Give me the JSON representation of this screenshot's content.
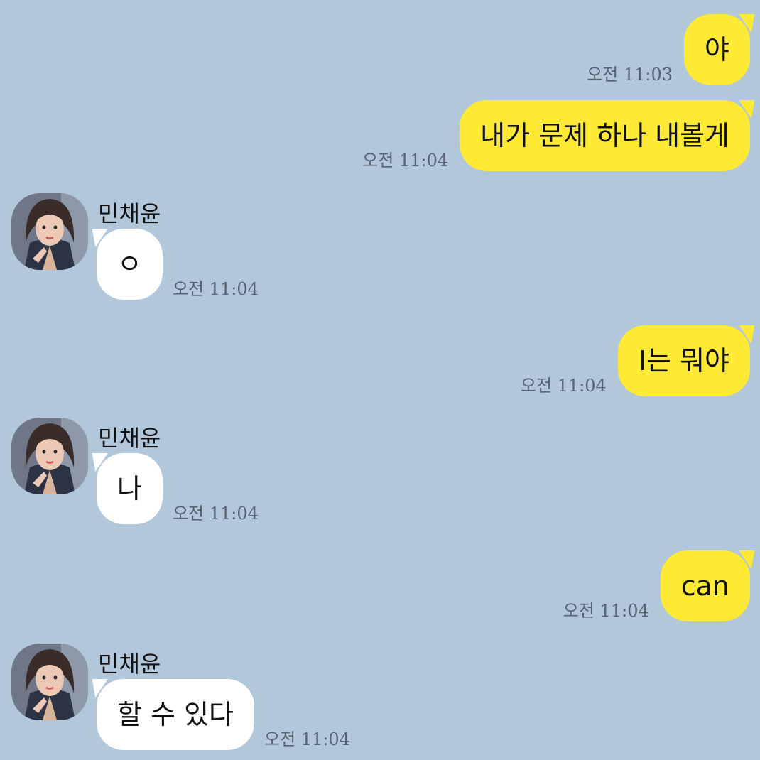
{
  "colors": {
    "background": "#b2c7da",
    "my_bubble": "#fee934",
    "their_bubble": "#ffffff",
    "timestamp": "#5a6470"
  },
  "messages": [
    {
      "from": "me",
      "text": "야",
      "time": "오전 11:03"
    },
    {
      "from": "me",
      "text": "내가 문제 하나 내볼게",
      "time": "오전 11:04"
    },
    {
      "from": "them",
      "sender": "민채윤",
      "text": "ㅇ",
      "time": "오전 11:04"
    },
    {
      "from": "me",
      "text": "I는 뭐야",
      "time": "오전 11:04"
    },
    {
      "from": "them",
      "sender": "민채윤",
      "text": "나",
      "time": "오전 11:04"
    },
    {
      "from": "me",
      "text": "can",
      "time": "오전 11:04"
    },
    {
      "from": "them",
      "sender": "민채윤",
      "text": "할 수 있다",
      "time": "오전 11:04"
    }
  ]
}
